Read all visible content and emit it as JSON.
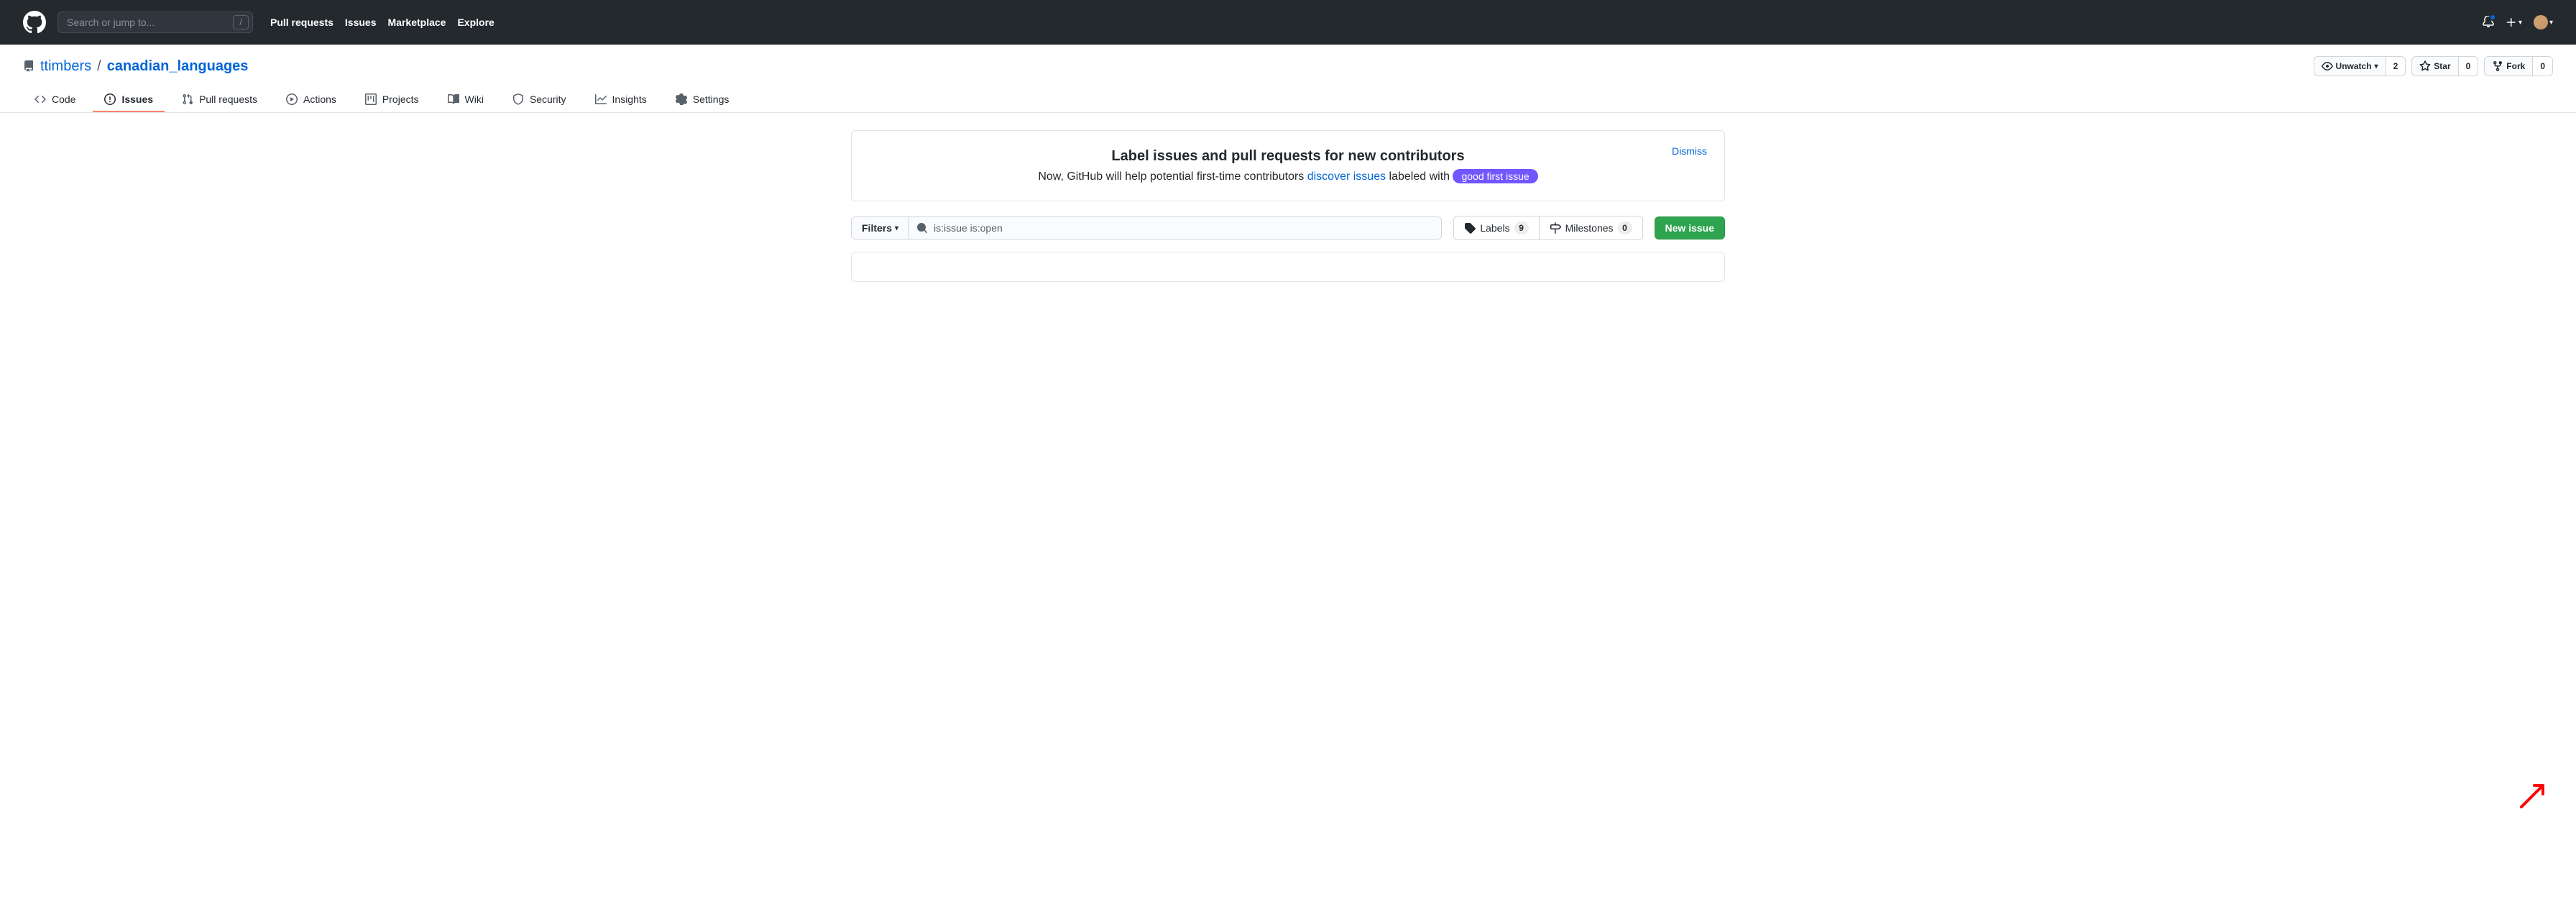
{
  "topnav": {
    "search_placeholder": "Search or jump to...",
    "links": [
      "Pull requests",
      "Issues",
      "Marketplace",
      "Explore"
    ]
  },
  "repo": {
    "owner": "ttimbers",
    "separator": "/",
    "name": "canadian_languages",
    "actions": {
      "watch": {
        "label": "Unwatch",
        "count": "2"
      },
      "star": {
        "label": "Star",
        "count": "0"
      },
      "fork": {
        "label": "Fork",
        "count": "0"
      }
    }
  },
  "tabs": {
    "code": "Code",
    "issues": "Issues",
    "pulls": "Pull requests",
    "actions": "Actions",
    "projects": "Projects",
    "wiki": "Wiki",
    "security": "Security",
    "insights": "Insights",
    "settings": "Settings"
  },
  "banner": {
    "title": "Label issues and pull requests for new contributors",
    "sub_prefix": "Now, GitHub will help potential first-time contributors ",
    "sub_link": "discover issues",
    "sub_suffix": " labeled with ",
    "label": "good first issue",
    "dismiss": "Dismiss"
  },
  "toolbar": {
    "filters": "Filters",
    "search_value": "is:issue is:open",
    "labels": {
      "label": "Labels",
      "count": "9"
    },
    "milestones": {
      "label": "Milestones",
      "count": "0"
    },
    "new_issue": "New issue"
  }
}
